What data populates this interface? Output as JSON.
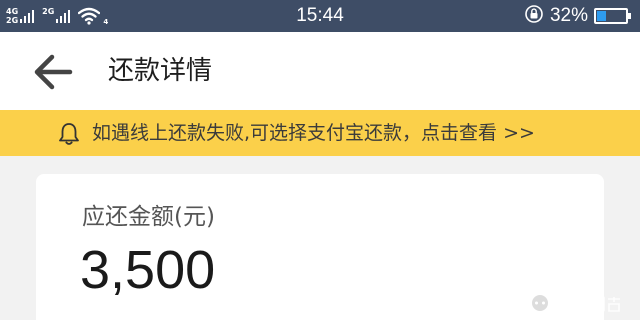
{
  "status_bar": {
    "network_top": "4G",
    "network_bottom": "2G",
    "network_mid": "2G",
    "wifi_sub": "4",
    "time": "15:44",
    "battery_percent": "32%",
    "battery_level": 0.32,
    "battery_fill_color": "#2e9cf0",
    "background": "#3e4d66"
  },
  "header": {
    "back_icon": "arrow-left-icon",
    "title": "还款详情"
  },
  "notice": {
    "icon": "bell-icon",
    "text": "如遇线上还款失败,可选择支付宝还款，点击查看 >>",
    "background": "#fbd04a"
  },
  "amount_card": {
    "label": "应还金额(元)",
    "value": "3,500"
  }
}
